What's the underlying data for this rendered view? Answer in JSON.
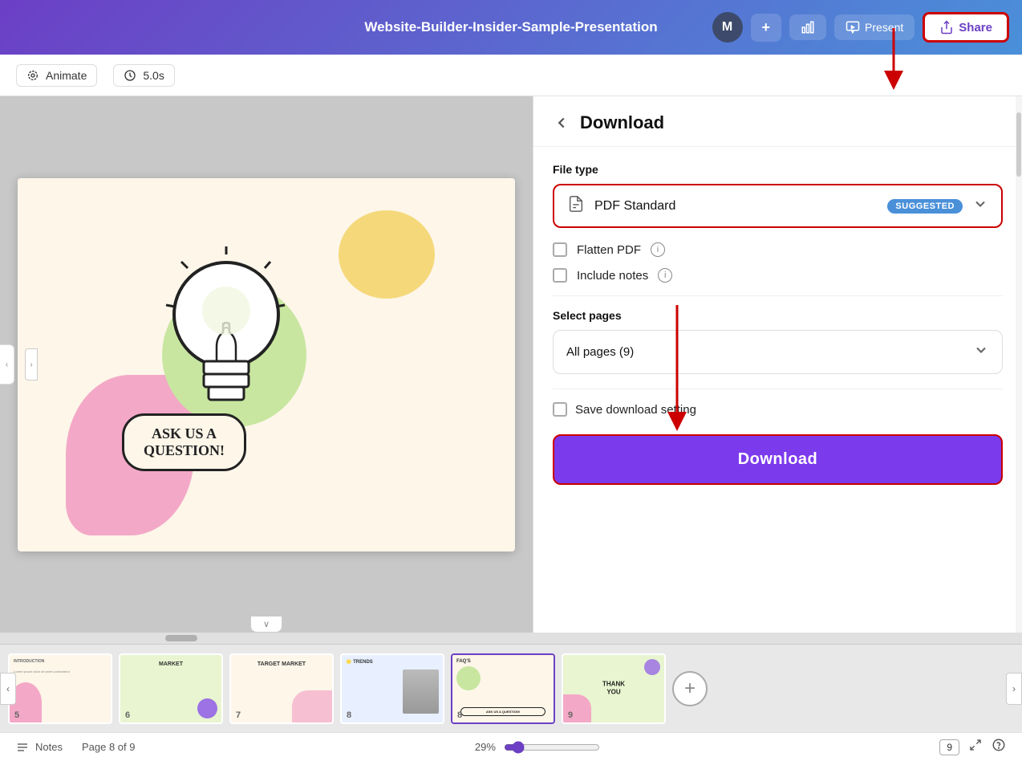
{
  "topbar": {
    "title": "Website-Builder-Insider-Sample-Presentation",
    "avatar_label": "M",
    "add_label": "+",
    "analytics_label": "",
    "present_label": "Present",
    "share_label": "Share"
  },
  "toolbar": {
    "animate_label": "Animate",
    "duration_label": "5.0s"
  },
  "panel": {
    "back_label": "‹",
    "title": "Download",
    "file_type_label": "File type",
    "file_type_value": "PDF Standard",
    "suggested_label": "SUGGESTED",
    "flatten_pdf_label": "Flatten PDF",
    "include_notes_label": "Include notes",
    "select_pages_label": "Select pages",
    "all_pages_value": "All pages (9)",
    "save_setting_label": "Save download setting",
    "download_btn_label": "Download"
  },
  "statusbar": {
    "notes_label": "Notes",
    "page_info": "Page 8 of 9",
    "zoom_percent": "29%",
    "page_count": "9"
  },
  "filmstrip": {
    "slides": [
      {
        "num": "5",
        "type": "intro",
        "bg": "cream"
      },
      {
        "num": "6",
        "type": "market",
        "bg": "green",
        "title": "MARKET"
      },
      {
        "num": "7",
        "type": "target",
        "bg": "cream",
        "title": "TARGET MARKET"
      },
      {
        "num": "8",
        "type": "trends",
        "bg": "blue",
        "title": "TRENDS"
      },
      {
        "num": "8",
        "type": "faq",
        "bg": "cream",
        "title": "FAQ'S",
        "active": true
      },
      {
        "num": "9",
        "type": "thankyou",
        "bg": "green",
        "title": "THANK YOU"
      }
    ]
  },
  "slide": {
    "question_label_1": "ASK US A",
    "question_label_2": "QUESTION!"
  }
}
